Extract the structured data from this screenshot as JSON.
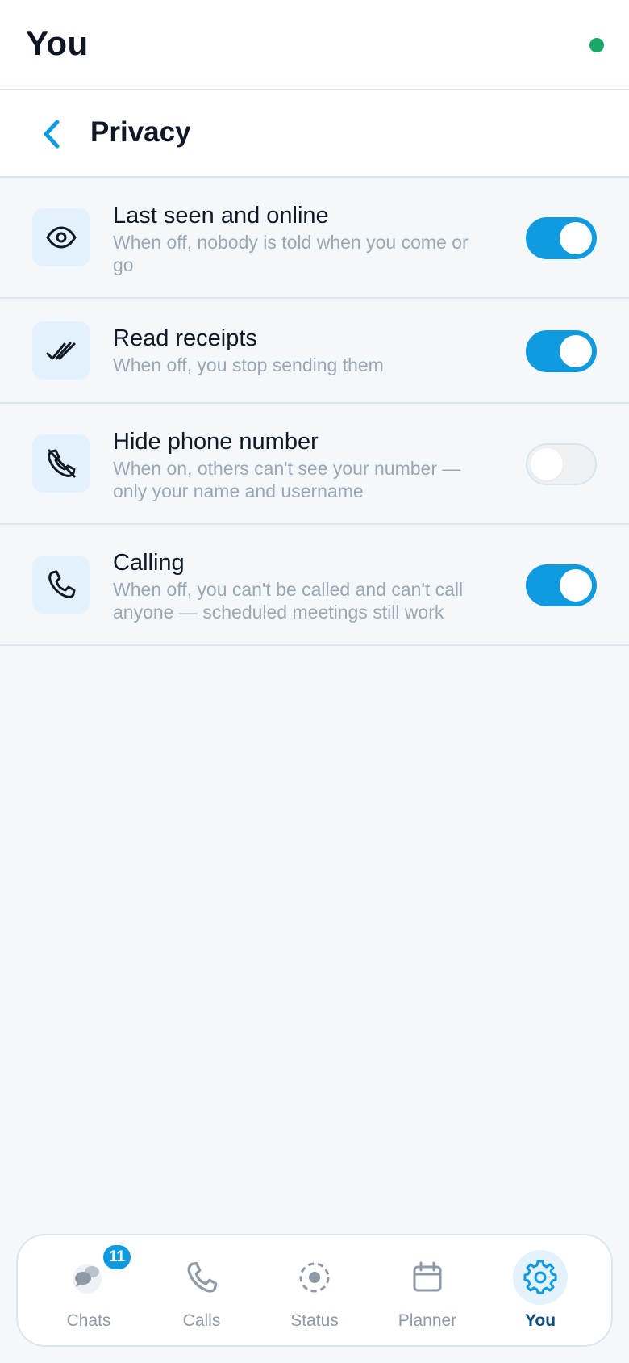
{
  "header": {
    "title": "You",
    "status_color": "#1aa96b"
  },
  "subheader": {
    "title": "Privacy"
  },
  "settings": [
    {
      "icon": "eye-icon",
      "label": "Last seen and online",
      "description": "When off, nobody is told when you come or go",
      "enabled": true
    },
    {
      "icon": "double-check-icon",
      "label": "Read receipts",
      "description": "When off, you stop sending them",
      "enabled": true
    },
    {
      "icon": "phone-hidden-icon",
      "label": "Hide phone number",
      "description": "When on, others can't see your number — only your name and username",
      "enabled": false
    },
    {
      "icon": "phone-icon",
      "label": "Calling",
      "description": "When off, you can't be called and can't call anyone — scheduled meetings still work",
      "enabled": true
    }
  ],
  "nav": {
    "items": [
      {
        "label": "Chats",
        "icon": "chat-bubbles-icon",
        "badge": "11",
        "active": false
      },
      {
        "label": "Calls",
        "icon": "phone-icon",
        "active": false
      },
      {
        "label": "Status",
        "icon": "status-ring-icon",
        "active": false
      },
      {
        "label": "Planner",
        "icon": "calendar-icon",
        "active": false
      },
      {
        "label": "You",
        "icon": "gear-icon",
        "active": true
      }
    ]
  },
  "colors": {
    "accent": "#109be0",
    "text": "#111827",
    "muted": "#9aa7b4",
    "background": "#f4f8fb"
  }
}
